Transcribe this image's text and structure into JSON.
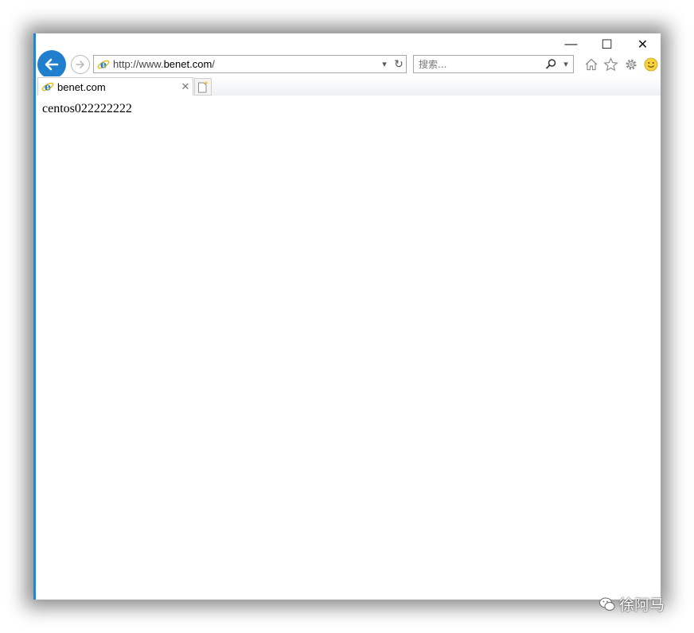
{
  "window": {
    "minimize_glyph": "—",
    "maximize_glyph": "☐",
    "close_glyph": "✕"
  },
  "toolbar": {
    "address": "http://www.benet.com/",
    "address_parts": {
      "prefix": "http://www.",
      "domain": "benet.com",
      "suffix": "/"
    },
    "search_placeholder": "搜索...",
    "dropdown_glyph": "▾",
    "refresh_glyph": "↻"
  },
  "tabs": [
    {
      "title": "benet.com",
      "close_glyph": "✕"
    }
  ],
  "page": {
    "body_text": "centos022222222"
  },
  "watermark": {
    "text": "徐阿马"
  },
  "colors": {
    "accent": "#1f7fce",
    "window_border": "#1a8ad4"
  },
  "icons": [
    "back-arrow-icon",
    "forward-arrow-icon",
    "ie-logo-icon",
    "search-icon",
    "home-icon",
    "favorites-star-icon",
    "settings-gear-icon",
    "smiley-feedback-icon",
    "new-tab-icon",
    "wechat-icon"
  ]
}
